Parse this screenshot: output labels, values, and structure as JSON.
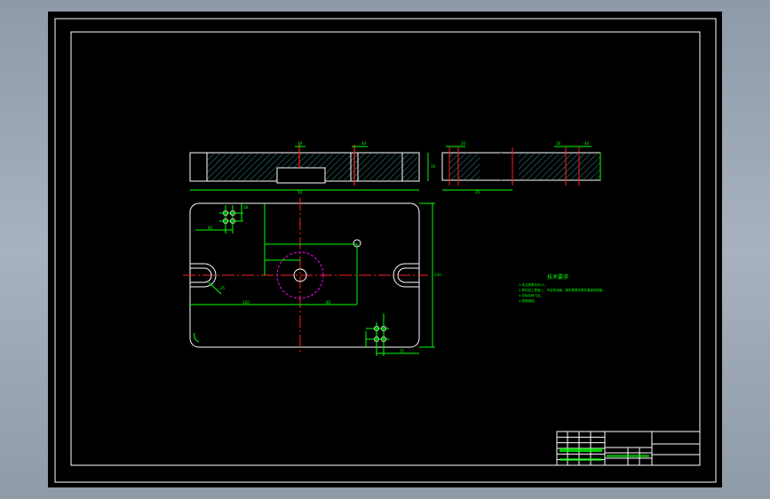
{
  "colors": {
    "background": "#000000",
    "outline": "#ffffff",
    "dimension": "#00ff00",
    "centerline": "#ff2020",
    "circle": "#ff00ff",
    "hatch": "#2f8f8f",
    "frame_bg": "#9aa5b2"
  },
  "front_view": {
    "dims": [
      "38",
      "40",
      "10",
      "50"
    ]
  },
  "side_view": {
    "dims": [
      "20",
      "16",
      "40",
      "20"
    ]
  },
  "plan_view": {
    "dims": [
      "60",
      "18",
      "120",
      "140",
      "80",
      "25",
      "25"
    ]
  },
  "notes": {
    "heading": "技术要求",
    "lines": [
      "1.未注倒角均为C1。",
      "2.零件加工表面上，不应有划痕、擦伤等损伤零件表面的缺陷。",
      "3.去除毛刺飞边。",
      "4.锐角倒钝。"
    ]
  },
  "title_block": {
    "rows": 6
  }
}
